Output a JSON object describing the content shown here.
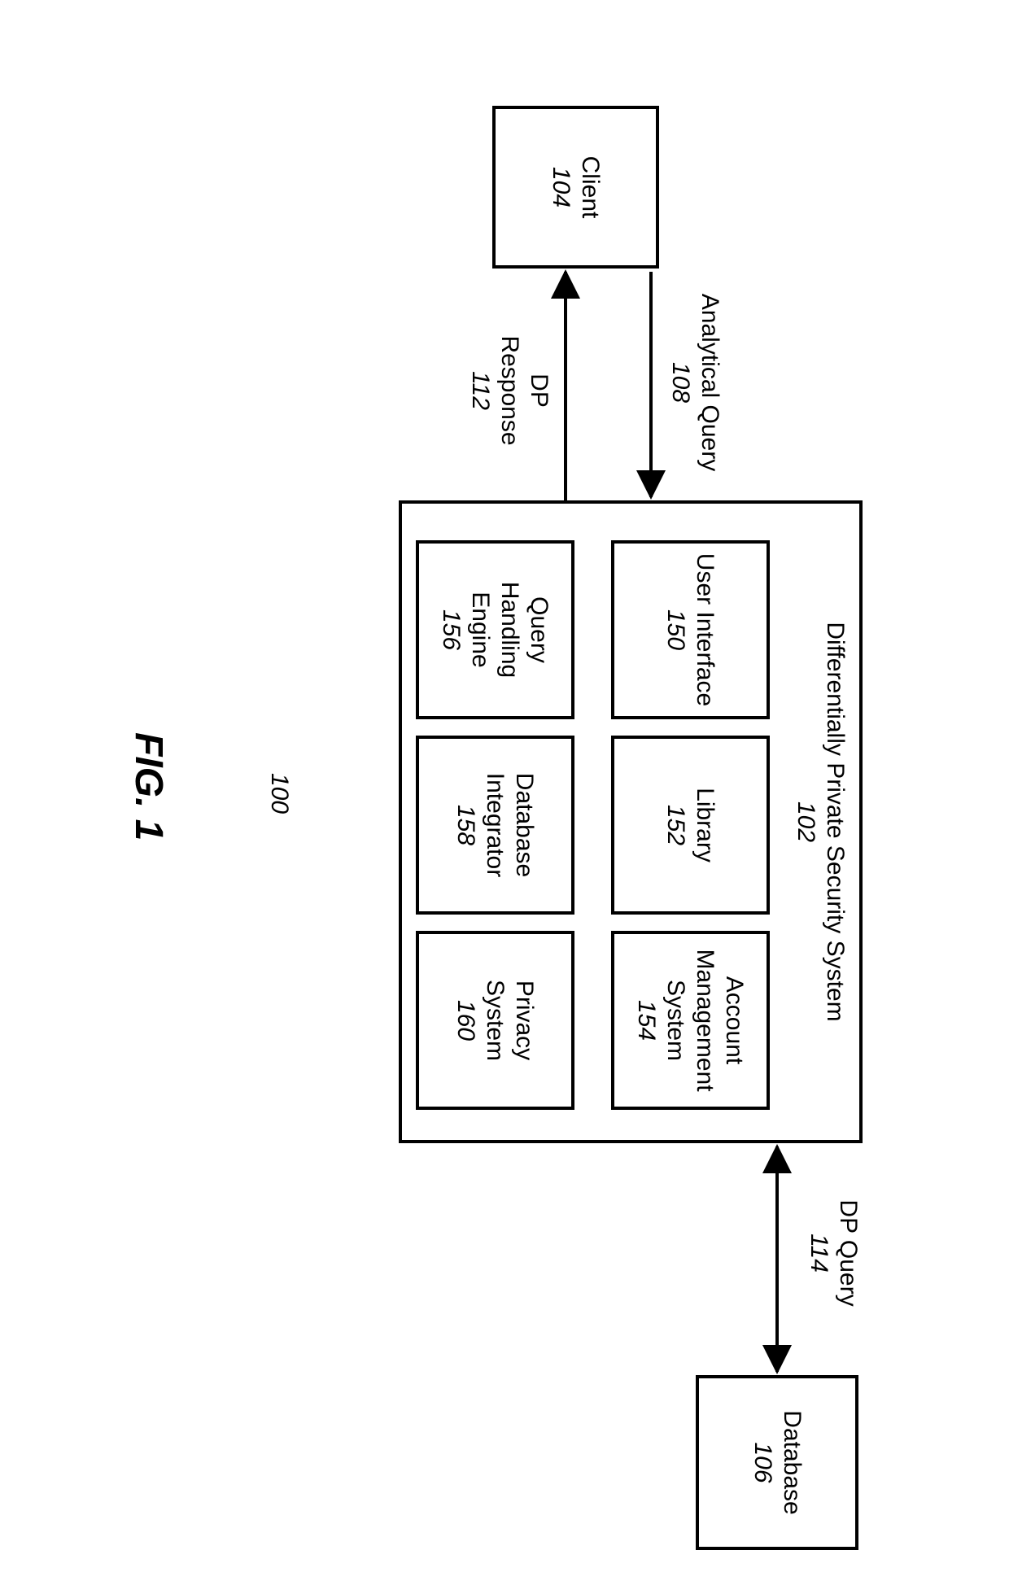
{
  "figure": {
    "title": "FIG. 1",
    "system_ref": "100"
  },
  "blocks": {
    "client": {
      "label": "Client",
      "ref": "104"
    },
    "dpss": {
      "label": "Differentially Private Security System",
      "ref": "102"
    },
    "database": {
      "label": "Database",
      "ref": "106"
    },
    "ui": {
      "label": "User Interface",
      "ref": "150"
    },
    "lib": {
      "label": "Library",
      "ref": "152"
    },
    "acct": {
      "label1": "Account",
      "label2": "Management",
      "label3": "System",
      "ref": "154"
    },
    "qhe": {
      "label1": "Query",
      "label2": "Handling",
      "label3": "Engine",
      "ref": "156"
    },
    "dbi": {
      "label1": "Database",
      "label2": "Integrator",
      "ref": "158"
    },
    "priv": {
      "label1": "Privacy",
      "label2": "System",
      "ref": "160"
    }
  },
  "connections": {
    "analytical_query": {
      "label": "Analytical Query",
      "ref": "108"
    },
    "dp_response": {
      "label1": "DP",
      "label2": "Response",
      "ref": "112"
    },
    "dp_query": {
      "label": "DP Query",
      "ref": "114"
    }
  }
}
